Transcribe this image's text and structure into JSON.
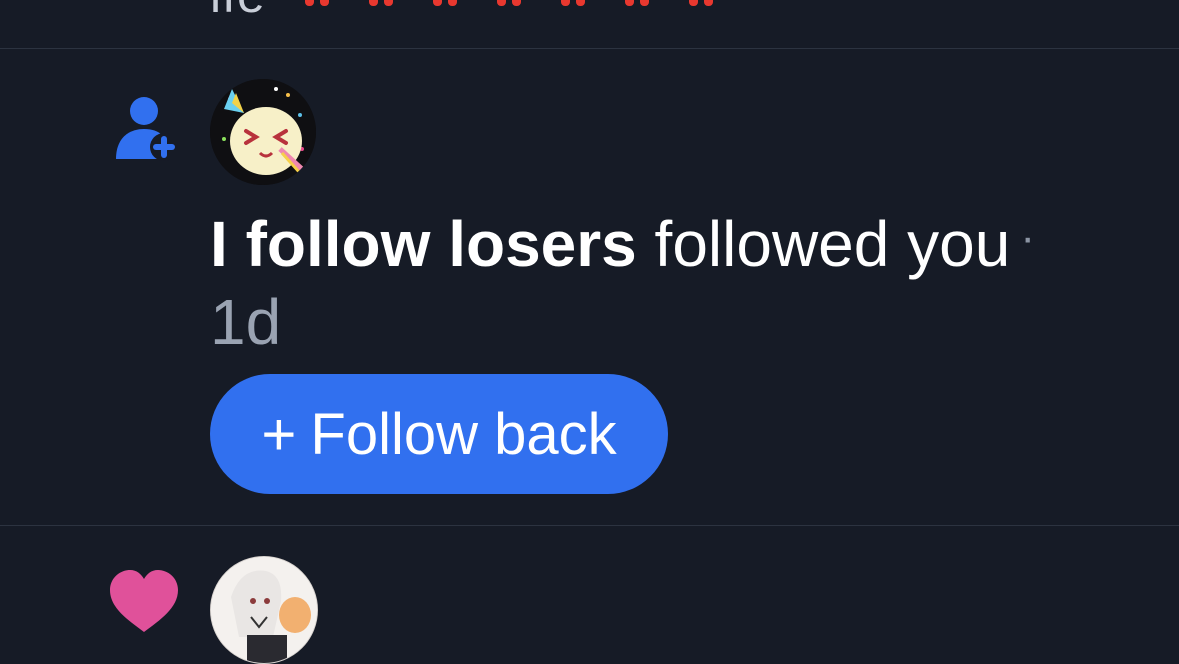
{
  "previous_item": {
    "text_fragment": "ife"
  },
  "notification": {
    "icon": "person-add-icon",
    "avatar": "party-face-avatar",
    "user_name": "I follow losers",
    "action_text": "followed you",
    "separator": "·",
    "time_ago": "1d",
    "follow_back_label": "Follow back",
    "follow_back_plus": "+"
  },
  "next_item": {
    "icon": "heart-icon",
    "avatar": "anime-avatar"
  },
  "colors": {
    "background": "#161b26",
    "accent": "#3170ef",
    "heart": "#e0519a",
    "divider": "#2c3340"
  }
}
